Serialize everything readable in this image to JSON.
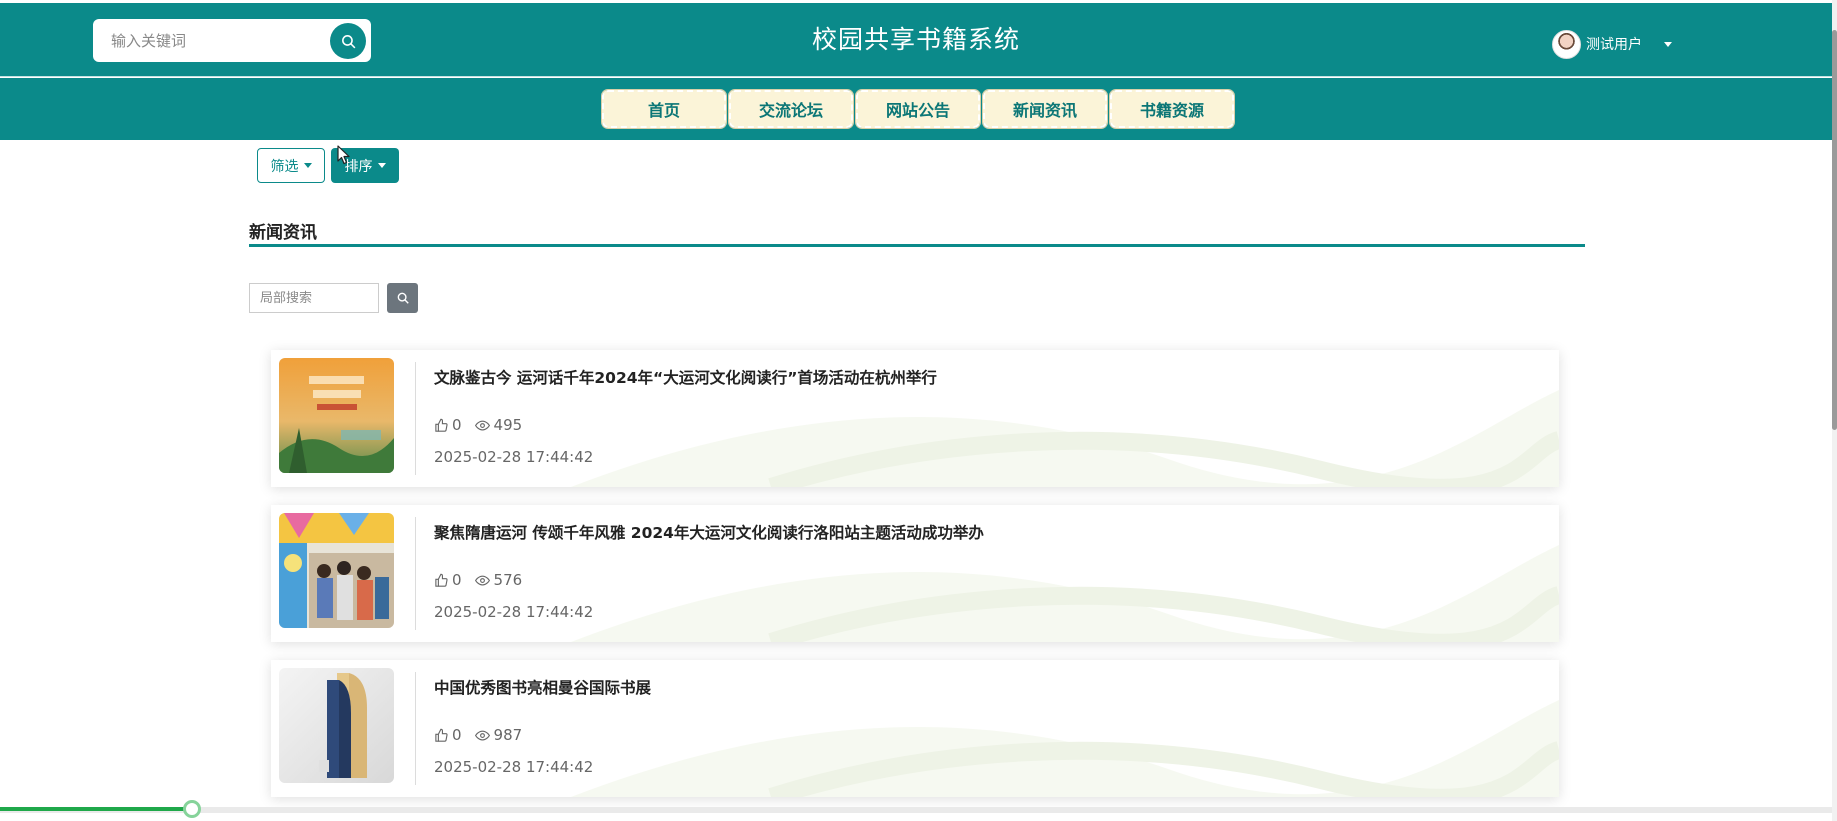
{
  "header": {
    "search_placeholder": "输入关键词",
    "site_title": "校园共享书籍系统",
    "user_name": "测试用户"
  },
  "nav": {
    "items": [
      {
        "label": "首页"
      },
      {
        "label": "交流论坛"
      },
      {
        "label": "网站公告"
      },
      {
        "label": "新闻资讯"
      },
      {
        "label": "书籍资源"
      }
    ],
    "active_index": 3
  },
  "toolbar": {
    "filter_label": "筛选",
    "sort_label": "排序"
  },
  "section": {
    "title": "新闻资讯",
    "local_search_placeholder": "局部搜索"
  },
  "news": [
    {
      "title": "文脉鉴古今 运河话千年2024年“大运河文化阅读行”首场活动在杭州举行",
      "likes": "0",
      "views": "495",
      "time": "2025-02-28 17:44:42"
    },
    {
      "title": "聚焦隋唐运河 传颂千年风雅 2024年大运河文化阅读行洛阳站主题活动成功举办",
      "likes": "0",
      "views": "576",
      "time": "2025-02-28 17:44:42"
    },
    {
      "title": "中国优秀图书亮相曼谷国际书展",
      "likes": "0",
      "views": "987",
      "time": "2025-02-28 17:44:42"
    }
  ],
  "player": {
    "progress": 0.105
  },
  "colors": {
    "primary": "#0b8a8a",
    "nav_item_bg": "#fbf4d8",
    "progress": "#1fa84a"
  }
}
